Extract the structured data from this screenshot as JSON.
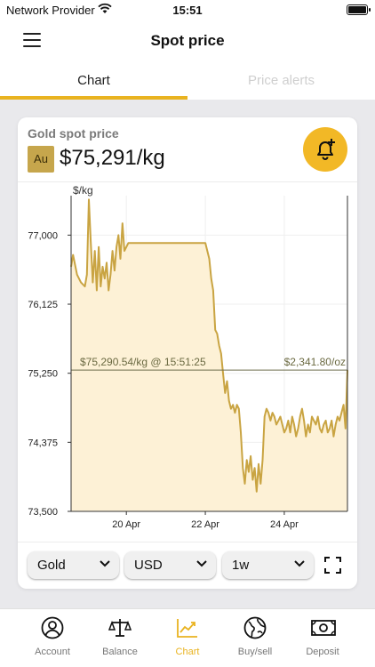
{
  "status": {
    "carrier": "Network Provider",
    "time": "15:51"
  },
  "header": {
    "title": "Spot price"
  },
  "tabs": [
    {
      "label": "Chart",
      "active": true
    },
    {
      "label": "Price alerts",
      "active": false
    }
  ],
  "card": {
    "subtitle": "Gold spot price",
    "symbol": "Au",
    "price": "$75,291/kg"
  },
  "chart_data": {
    "type": "area",
    "ylabel": "$/kg",
    "y_ticks": [
      "77,000",
      "76,125",
      "75,250",
      "74,375",
      "73,500"
    ],
    "y_tick_values": [
      77000,
      76125,
      75250,
      74375,
      73500
    ],
    "ylim": [
      73500,
      77500
    ],
    "x_ticks": [
      "20 Apr",
      "22 Apr",
      "24 Apr"
    ],
    "x_tick_positions": [
      20,
      22,
      24
    ],
    "xlim": [
      18.6,
      25.6
    ],
    "current_line": {
      "value": 75290.54,
      "left_label": "$75,290.54/kg @ 15:51:25",
      "right_label": "$2,341.80/oz"
    },
    "series": [
      {
        "x": [
          18.6,
          18.65,
          18.75,
          18.85,
          18.95,
          19.0,
          19.05,
          19.1,
          19.15,
          19.2,
          19.25,
          19.3,
          19.35,
          19.4,
          19.45,
          19.5,
          19.55,
          19.6,
          19.65,
          19.7,
          19.75,
          19.8,
          19.85,
          19.9,
          19.95,
          20.0,
          20.05,
          20.1,
          20.6,
          21.0,
          21.5,
          21.9,
          22.0,
          22.1,
          22.15,
          22.2,
          22.25,
          22.3,
          22.35,
          22.4,
          22.45,
          22.5,
          22.55,
          22.6,
          22.65,
          22.7,
          22.75,
          22.8,
          22.85,
          22.9,
          22.95,
          23.0,
          23.05,
          23.1,
          23.15,
          23.2,
          23.25,
          23.3,
          23.35,
          23.4,
          23.45,
          23.5,
          23.55,
          23.6,
          23.65,
          23.7,
          23.75,
          23.8,
          23.85,
          23.9,
          23.95,
          24.0,
          24.05,
          24.1,
          24.15,
          24.2,
          24.25,
          24.3,
          24.35,
          24.4,
          24.45,
          24.5,
          24.55,
          24.6,
          24.65,
          24.7,
          24.75,
          24.8,
          24.85,
          24.9,
          24.95,
          25.0,
          25.05,
          25.1,
          25.15,
          25.2,
          25.25,
          25.3,
          25.35,
          25.4,
          25.45,
          25.5,
          25.55,
          25.6
        ],
        "y": [
          76600,
          76750,
          76500,
          76400,
          76350,
          76500,
          77450,
          76900,
          76400,
          76800,
          76300,
          76850,
          76350,
          76600,
          76450,
          76650,
          76300,
          76500,
          76800,
          76550,
          76850,
          77000,
          76700,
          77150,
          76800,
          76850,
          76900,
          76900,
          76900,
          76900,
          76900,
          76900,
          76900,
          76700,
          76450,
          76300,
          75800,
          75750,
          75600,
          75500,
          75250,
          75000,
          75150,
          74900,
          74800,
          74850,
          74750,
          74850,
          74800,
          74500,
          74050,
          73850,
          74150,
          74000,
          74200,
          73900,
          74050,
          73750,
          74100,
          73850,
          74150,
          74700,
          74800,
          74750,
          74650,
          74750,
          74700,
          74600,
          74650,
          74700,
          74600,
          74500,
          74550,
          74650,
          74500,
          74700,
          74600,
          74450,
          74550,
          74700,
          74800,
          74650,
          74450,
          74600,
          74500,
          74700,
          74650,
          74600,
          74700,
          74550,
          74500,
          74600,
          74650,
          74500,
          74550,
          74650,
          74450,
          74600,
          74700,
          74650,
          74750,
          74850,
          74550,
          75290
        ]
      }
    ]
  },
  "controls": {
    "metal": "Gold",
    "currency": "USD",
    "range": "1w"
  },
  "tabbar": [
    {
      "label": "Account",
      "icon": "account-icon"
    },
    {
      "label": "Balance",
      "icon": "balance-scale-icon"
    },
    {
      "label": "Chart",
      "icon": "chart-trend-icon",
      "active": true
    },
    {
      "label": "Buy/sell",
      "icon": "globe-icon"
    },
    {
      "label": "Deposit",
      "icon": "deposit-cash-icon"
    }
  ],
  "colors": {
    "accent": "#e9b320",
    "chart_line": "#c9a442",
    "chart_fill": "#fdf1d6",
    "badge": "#c6a64c"
  }
}
